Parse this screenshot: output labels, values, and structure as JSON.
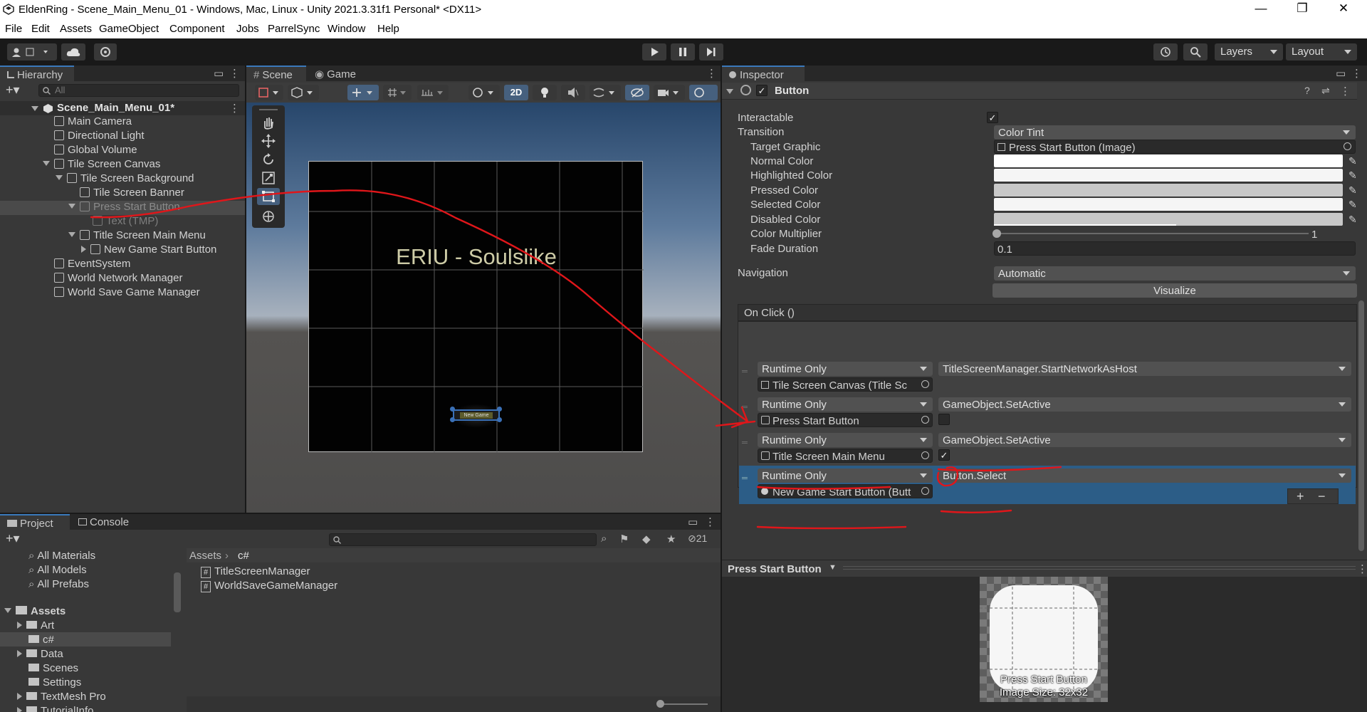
{
  "window": {
    "title": "EldenRing - Scene_Main_Menu_01 - Windows, Mac, Linux - Unity 2021.3.31f1 Personal* <DX11>",
    "minimize": "—",
    "maximize": "❐",
    "close": "✕"
  },
  "menu": [
    "File",
    "Edit",
    "Assets",
    "GameObject",
    "Component",
    "Jobs",
    "ParrelSync",
    "Window",
    "Help"
  ],
  "toolbar": {
    "layers": "Layers",
    "layout": "Layout"
  },
  "hierarchy": {
    "tab": "Hierarchy",
    "search_placeholder": "All",
    "scene": "Scene_Main_Menu_01*",
    "items": [
      {
        "label": "Main Camera"
      },
      {
        "label": "Directional Light"
      },
      {
        "label": "Global Volume"
      },
      {
        "label": "Tile Screen Canvas"
      },
      {
        "label": "Tile Screen Background"
      },
      {
        "label": "Tile Screen Banner"
      },
      {
        "label": "Press Start Button"
      },
      {
        "label": "Text (TMP)"
      },
      {
        "label": "Title Screen Main Menu"
      },
      {
        "label": "New Game Start Button"
      },
      {
        "label": "EventSystem"
      },
      {
        "label": "World Network Manager"
      },
      {
        "label": "World Save Game Manager"
      }
    ]
  },
  "scene": {
    "tabs": [
      "Scene",
      "Game"
    ],
    "mode_2d": "2D",
    "banner_text": "ERIU - Soulslike",
    "button_text": "New Game"
  },
  "project": {
    "tabs": [
      "Project",
      "Console"
    ],
    "count": "21",
    "favorites": [
      "All Materials",
      "All Models",
      "All Prefabs"
    ],
    "assets_root": "Assets",
    "folders": [
      "Art",
      "c#",
      "Data",
      "Scenes",
      "Settings",
      "TextMesh Pro",
      "TutorialInfo"
    ],
    "breadcrumb": [
      "Assets",
      "c#"
    ],
    "files": [
      "TitleScreenManager",
      "WorldSaveGameManager"
    ]
  },
  "inspector": {
    "tab": "Inspector",
    "component": "Button",
    "interactable_label": "Interactable",
    "transition_label": "Transition",
    "transition_value": "Color Tint",
    "target_graphic_label": "Target Graphic",
    "target_graphic_value": "Press Start Button (Image)",
    "colors": [
      {
        "label": "Normal Color",
        "color": "#ffffff"
      },
      {
        "label": "Highlighted Color",
        "color": "#f5f5f5"
      },
      {
        "label": "Pressed Color",
        "color": "#c8c8c8"
      },
      {
        "label": "Selected Color",
        "color": "#f5f5f5"
      },
      {
        "label": "Disabled Color",
        "color": "#c8c8c8"
      }
    ],
    "multiplier_label": "Color Multiplier",
    "multiplier_value": "1",
    "fade_label": "Fade Duration",
    "fade_value": "0.1",
    "navigation_label": "Navigation",
    "navigation_value": "Automatic",
    "visualize": "Visualize",
    "onclick_header": "On Click ()",
    "events": [
      {
        "mode": "Runtime Only",
        "function": "TitleScreenManager.StartNetworkAsHost",
        "target": "Tile Screen Canvas (Title Sc"
      },
      {
        "mode": "Runtime Only",
        "function": "GameObject.SetActive",
        "target": "Press Start Button",
        "checked": false
      },
      {
        "mode": "Runtime Only",
        "function": "GameObject.SetActive",
        "target": "Title Screen Main Menu",
        "checked": true
      },
      {
        "mode": "Runtime Only",
        "function": "Button.Select",
        "target": "New Game Start Button (Butt"
      }
    ],
    "add": "+",
    "remove": "−"
  },
  "preview": {
    "title": "Press Start Button",
    "caption_name": "Press Start Button",
    "caption_size": "Image Size: 32x32"
  }
}
